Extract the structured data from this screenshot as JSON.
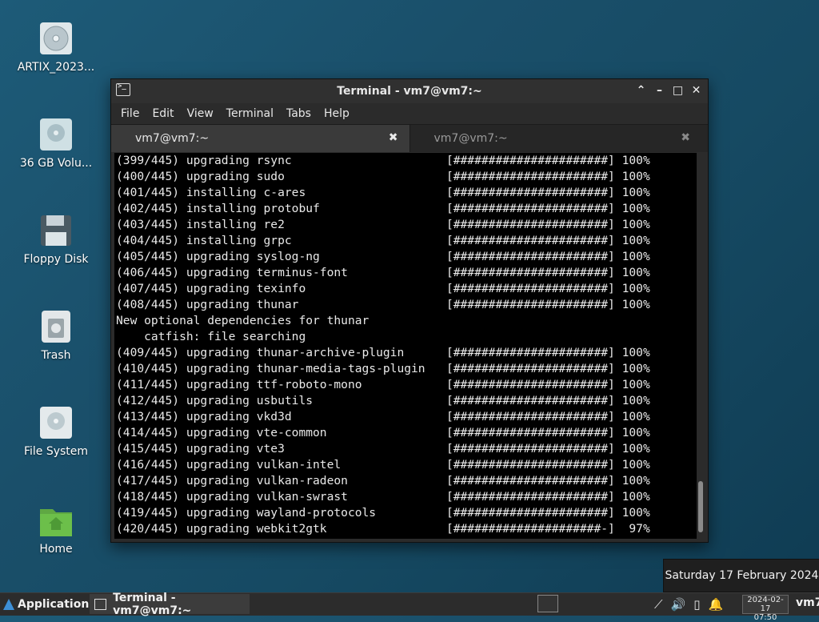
{
  "desktop": {
    "icons": [
      {
        "label": "ARTIX_2023..."
      },
      {
        "label": "36 GB Volu..."
      },
      {
        "label": "Floppy Disk"
      },
      {
        "label": "Trash"
      },
      {
        "label": "File System"
      },
      {
        "label": "Home"
      }
    ]
  },
  "window": {
    "title": "Terminal - vm7@vm7:~",
    "menu": [
      "File",
      "Edit",
      "View",
      "Terminal",
      "Tabs",
      "Help"
    ],
    "tabs": [
      {
        "label": "vm7@vm7:~",
        "active": true
      },
      {
        "label": "vm7@vm7:~",
        "active": false
      }
    ],
    "close_glyph": "✖"
  },
  "terminal": {
    "lines": [
      "(399/445) upgrading rsync                      [######################] 100%",
      "(400/445) upgrading sudo                       [######################] 100%",
      "(401/445) installing c-ares                    [######################] 100%",
      "(402/445) installing protobuf                  [######################] 100%",
      "(403/445) installing re2                       [######################] 100%",
      "(404/445) installing grpc                      [######################] 100%",
      "(405/445) upgrading syslog-ng                  [######################] 100%",
      "(406/445) upgrading terminus-font              [######################] 100%",
      "(407/445) upgrading texinfo                    [######################] 100%",
      "(408/445) upgrading thunar                     [######################] 100%",
      "New optional dependencies for thunar",
      "    catfish: file searching",
      "(409/445) upgrading thunar-archive-plugin      [######################] 100%",
      "(410/445) upgrading thunar-media-tags-plugin   [######################] 100%",
      "(411/445) upgrading ttf-roboto-mono            [######################] 100%",
      "(412/445) upgrading usbutils                   [######################] 100%",
      "(413/445) upgrading vkd3d                      [######################] 100%",
      "(414/445) upgrading vte-common                 [######################] 100%",
      "(415/445) upgrading vte3                       [######################] 100%",
      "(416/445) upgrading vulkan-intel               [######################] 100%",
      "(417/445) upgrading vulkan-radeon              [######################] 100%",
      "(418/445) upgrading vulkan-swrast              [######################] 100%",
      "(419/445) upgrading wayland-protocols          [######################] 100%",
      "(420/445) upgrading webkit2gtk                 [#####################-]  97%"
    ]
  },
  "tooltip": {
    "text": "Saturday 17 February 2024"
  },
  "taskbar": {
    "applications_label": "Applications",
    "task_label": "Terminal - vm7@vm7:~",
    "clock_date": "2024-02-17",
    "clock_time": "07:50",
    "user": "vm7"
  },
  "colors": {
    "desktop_bg": "#1a4f6a",
    "terminal_bg": "#000000",
    "terminal_fg": "#e9e9e9",
    "accent": "#3d8fd6"
  }
}
